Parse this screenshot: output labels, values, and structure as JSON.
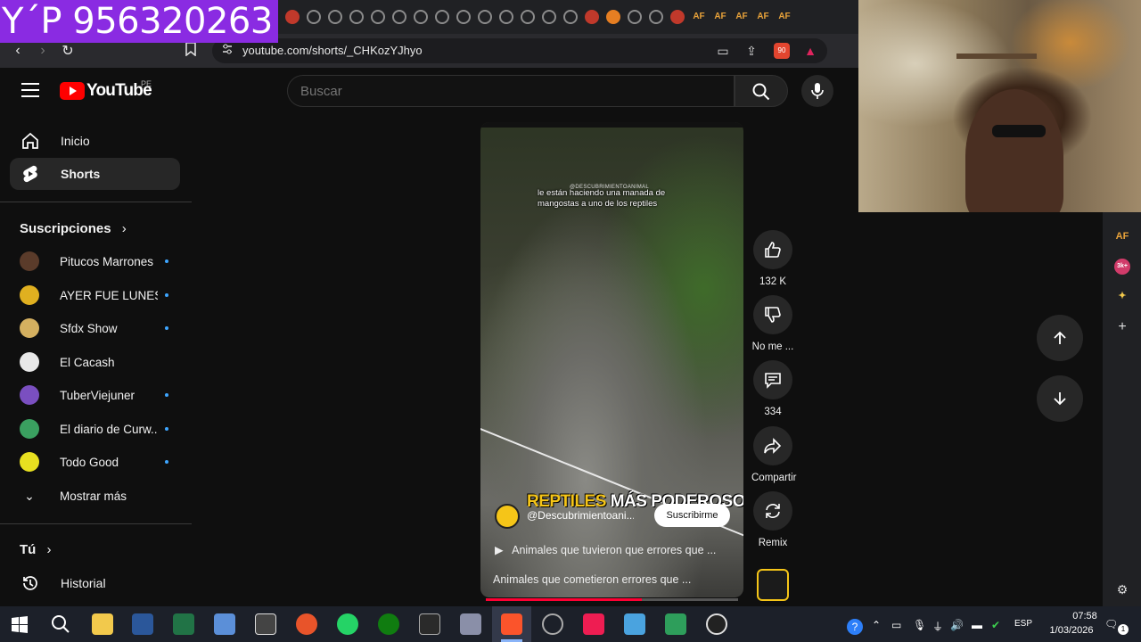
{
  "overlay_text": "Y´P 956320263",
  "browser": {
    "url": "youtube.com/shorts/_CHKozYJhyo",
    "tab_af_label": "AF",
    "shield_badge": "90"
  },
  "youtube": {
    "brand": "YouTube",
    "region": "PE",
    "search_placeholder": "Buscar"
  },
  "sidebar": {
    "home": "Inicio",
    "shorts": "Shorts",
    "subscriptions_heading": "Suscripciones",
    "subscriptions": [
      {
        "name": "Pitucos Marrones",
        "color": "#5a3b2a",
        "new": true
      },
      {
        "name": "AYER FUE LUNES",
        "color": "#e0b020",
        "new": true
      },
      {
        "name": "Sfdx Show",
        "color": "#d4b060",
        "new": true
      },
      {
        "name": "El Cacash",
        "color": "#e8e8e8",
        "new": false
      },
      {
        "name": "TuberViejuner",
        "color": "#7a4fc0",
        "new": true
      },
      {
        "name": "El diario de Curw...",
        "color": "#3aa060",
        "new": true
      },
      {
        "name": "Todo Good",
        "color": "#e8e020",
        "new": true
      }
    ],
    "show_more": "Mostrar más",
    "you_heading": "Tú",
    "history": "Historial"
  },
  "short": {
    "caption_top": "le están haciendo una manada de mangostas a uno de los reptiles",
    "watermark": "@DESCUBRIMIENTOANIMAL",
    "title_yellow": "REPTILES",
    "title_white": "MÁS PODEROSOS",
    "channel_handle": "@Descubrimientoani...",
    "subscribe": "Suscribirme",
    "playlist": "Animales que tuvieron que errores que ...",
    "video_title": "Animales que cometieron errores que ...",
    "progress": 0.62
  },
  "actions": {
    "likes": "132 K",
    "dislike": "No me ...",
    "comments": "334",
    "share": "Compartir",
    "remix": "Remix"
  },
  "taskbar": {
    "time": "07:58",
    "date": "1/03/2026",
    "lang": "ESP",
    "notif_count": "1"
  },
  "right_strip": {
    "af": "AF",
    "badge": "3k+"
  }
}
